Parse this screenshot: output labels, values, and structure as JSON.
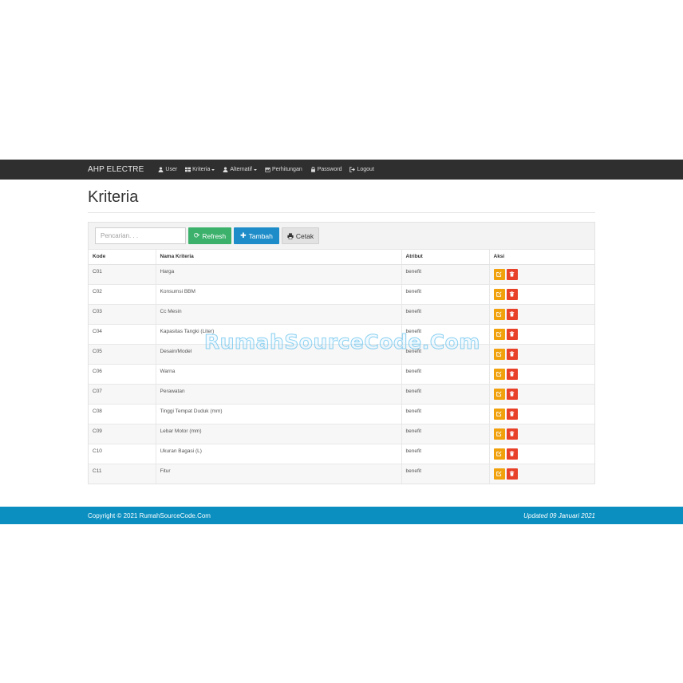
{
  "navbar": {
    "brand": "AHP ELECTRE",
    "items": [
      {
        "label": "User",
        "icon": "user-icon",
        "dropdown": false
      },
      {
        "label": "Kriteria",
        "icon": "grid-icon",
        "dropdown": true
      },
      {
        "label": "Alternatif",
        "icon": "user-icon",
        "dropdown": true
      },
      {
        "label": "Perhitungan",
        "icon": "calendar-icon",
        "dropdown": false
      },
      {
        "label": "Password",
        "icon": "lock-icon",
        "dropdown": false
      },
      {
        "label": "Logout",
        "icon": "logout-icon",
        "dropdown": false
      }
    ]
  },
  "page": {
    "title": "Kriteria"
  },
  "toolbar": {
    "search_placeholder": "Pencarian. . .",
    "refresh_label": "Refresh",
    "tambah_label": "Tambah",
    "cetak_label": "Cetak"
  },
  "table": {
    "headers": [
      "Kode",
      "Nama Kriteria",
      "Atribut",
      "Aksi"
    ],
    "rows": [
      {
        "kode": "C01",
        "nama": "Harga",
        "atribut": "benefit"
      },
      {
        "kode": "C02",
        "nama": "Konsumsi BBM",
        "atribut": "benefit"
      },
      {
        "kode": "C03",
        "nama": "Cc Mesin",
        "atribut": "benefit"
      },
      {
        "kode": "C04",
        "nama": "Kapasitas Tangki (Liter)",
        "atribut": "benefit"
      },
      {
        "kode": "C05",
        "nama": "Desain/Model",
        "atribut": "benefit"
      },
      {
        "kode": "C06",
        "nama": "Warna",
        "atribut": "benefit"
      },
      {
        "kode": "C07",
        "nama": "Perawatan",
        "atribut": "benefit"
      },
      {
        "kode": "C08",
        "nama": "Tinggi Tempat Duduk (mm)",
        "atribut": "benefit"
      },
      {
        "kode": "C09",
        "nama": "Lebar Motor (mm)",
        "atribut": "benefit"
      },
      {
        "kode": "C10",
        "nama": "Ukuran Bagasi (L)",
        "atribut": "benefit"
      },
      {
        "kode": "C11",
        "nama": "Fitur",
        "atribut": "benefit"
      }
    ]
  },
  "watermark": "RumahSourceCode.Com",
  "footer": {
    "copyright": "Copyright © 2021 RumahSourceCode.Com",
    "updated": "Updated 09 Januari 2021"
  },
  "colors": {
    "navbar": "#2f2f2f",
    "refresh": "#3bb16b",
    "tambah": "#1d8cc8",
    "edit": "#f0a10c",
    "delete": "#e8412a",
    "footer": "#0a8fc0"
  }
}
